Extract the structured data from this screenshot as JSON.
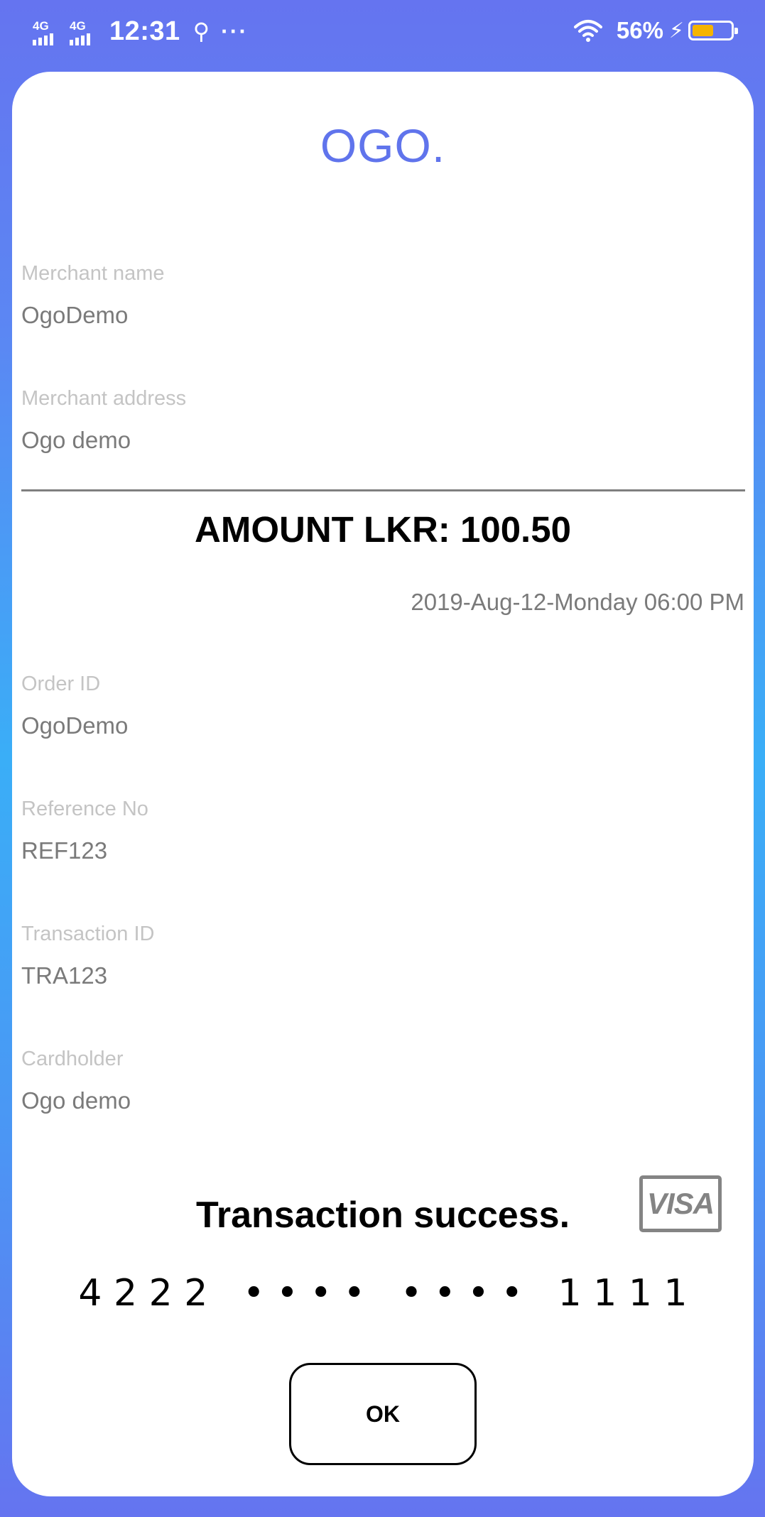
{
  "status_bar": {
    "network_1": "4G",
    "network_2": "4G",
    "time": "12:31",
    "more": "···",
    "battery_percent": "56%",
    "battery_level": 0.56,
    "battery_color": "#f5b400"
  },
  "app": {
    "logo": "OGO."
  },
  "merchant": {
    "name_label": "Merchant name",
    "name_value": "OgoDemo",
    "address_label": "Merchant address",
    "address_value": "Ogo demo"
  },
  "transaction": {
    "amount": "AMOUNT LKR: 100.50",
    "datetime": "2019-Aug-12-Monday 06:00 PM",
    "order_label": "Order ID",
    "order_value": "OgoDemo",
    "reference_label": "Reference No",
    "reference_value": "REF123",
    "txn_label": "Transaction ID",
    "txn_value": "TRA123",
    "cardholder_label": "Cardholder",
    "cardholder_value": "Ogo demo",
    "status_message": "Transaction success.",
    "card_brand": "VISA",
    "card_number": "4 2 2 2   • • • •   • • • •   1 1 1 1"
  },
  "actions": {
    "ok_label": "OK"
  },
  "colors": {
    "accent": "#6074ec",
    "background_top": "#6574f0",
    "background_mid": "#3aaef7"
  }
}
